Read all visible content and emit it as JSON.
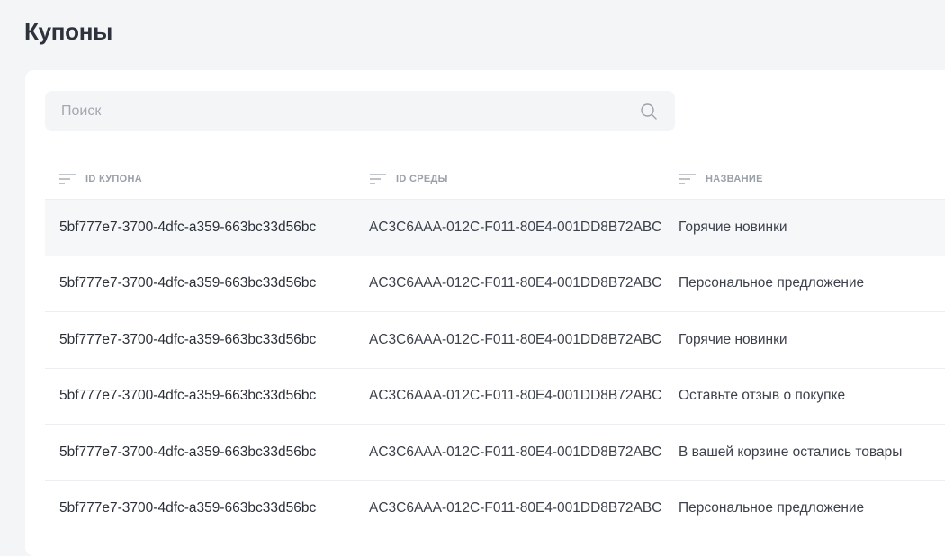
{
  "page": {
    "title": "Купоны"
  },
  "search": {
    "placeholder": "Поиск",
    "value": ""
  },
  "table": {
    "columns": [
      {
        "label": "ID КУПОНА"
      },
      {
        "label": "ID СРЕДЫ"
      },
      {
        "label": "НАЗВАНИЕ"
      }
    ],
    "rows": [
      {
        "coupon_id": "5bf777e7-3700-4dfc-a359-663bc33d56bc",
        "env_id": "AC3C6AAA-012C-F011-80E4-001DD8B72ABC",
        "name": "Горячие новинки"
      },
      {
        "coupon_id": "5bf777e7-3700-4dfc-a359-663bc33d56bc",
        "env_id": "AC3C6AAA-012C-F011-80E4-001DD8B72ABC",
        "name": "Персональное предложение"
      },
      {
        "coupon_id": "5bf777e7-3700-4dfc-a359-663bc33d56bc",
        "env_id": "AC3C6AAA-012C-F011-80E4-001DD8B72ABC",
        "name": "Горячие новинки"
      },
      {
        "coupon_id": "5bf777e7-3700-4dfc-a359-663bc33d56bc",
        "env_id": "AC3C6AAA-012C-F011-80E4-001DD8B72ABC",
        "name": "Оставьте отзыв о покупке"
      },
      {
        "coupon_id": "5bf777e7-3700-4dfc-a359-663bc33d56bc",
        "env_id": "AC3C6AAA-012C-F011-80E4-001DD8B72ABC",
        "name": "В вашей корзине остались товары"
      },
      {
        "coupon_id": "5bf777e7-3700-4dfc-a359-663bc33d56bc",
        "env_id": "AC3C6AAA-012C-F011-80E4-001DD8B72ABC",
        "name": "Персональное предложение"
      }
    ]
  },
  "icons": {
    "search": "search-icon",
    "sort": "sort-lines-icon"
  },
  "colors": {
    "background": "#f4f5f7",
    "card": "#ffffff",
    "header_text": "#9a9fa8",
    "row_highlight": "#f6f7f9"
  }
}
